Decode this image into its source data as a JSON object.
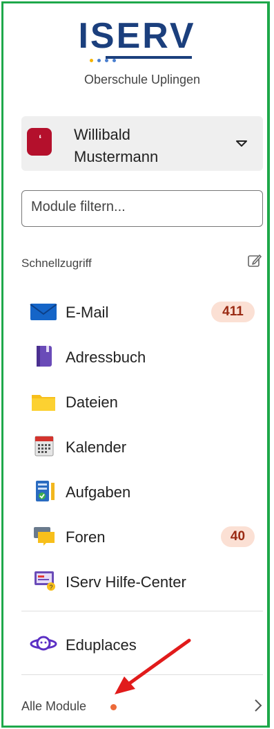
{
  "brand": {
    "logo_text": "ISERV",
    "school_name": "Oberschule Uplingen",
    "dot_colors": [
      "#f5b400",
      "#4a7fd0",
      "#4a7fd0",
      "#4a7fd0"
    ]
  },
  "user": {
    "name": "Willibald Mustermann",
    "avatar_color": "#b4102c"
  },
  "filter": {
    "placeholder": "Module filtern..."
  },
  "quick_access": {
    "title": "Schnellzugriff",
    "items": [
      {
        "label": "E-Mail",
        "icon": "mail-icon",
        "badge": "411"
      },
      {
        "label": "Adressbuch",
        "icon": "addressbook-icon",
        "badge": null
      },
      {
        "label": "Dateien",
        "icon": "folder-icon",
        "badge": null
      },
      {
        "label": "Kalender",
        "icon": "calendar-icon",
        "badge": null
      },
      {
        "label": "Aufgaben",
        "icon": "tasks-icon",
        "badge": null
      },
      {
        "label": "Foren",
        "icon": "forum-icon",
        "badge": "40"
      },
      {
        "label": "IServ Hilfe-Center",
        "icon": "help-center-icon",
        "badge": null
      }
    ]
  },
  "extra": {
    "label": "Eduplaces",
    "icon": "eduplaces-icon"
  },
  "all_modules": {
    "label": "Alle Module",
    "dot_color": "#ec6a3a"
  },
  "colors": {
    "accent_frame": "#1ea84a",
    "badge_bg": "#fbe0d4",
    "badge_text": "#9a2a13",
    "annotation_arrow": "#e11b1b"
  }
}
